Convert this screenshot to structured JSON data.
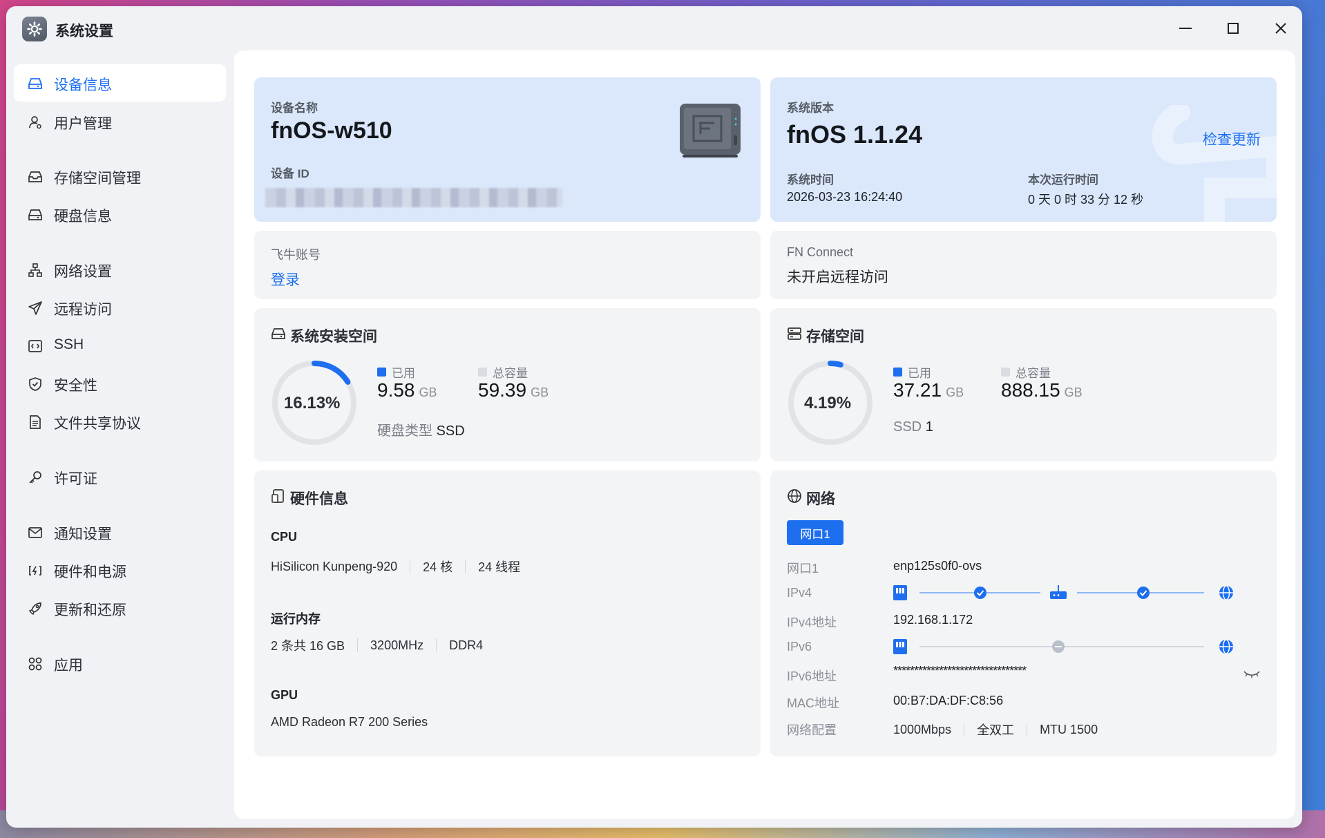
{
  "window": {
    "title": "系统设置"
  },
  "sidebar": {
    "items": [
      {
        "label": "设备信息",
        "icon": "device-drive-icon",
        "active": true
      },
      {
        "label": "用户管理",
        "icon": "user-icon"
      },
      {
        "label": "存储空间管理",
        "icon": "storage-icon"
      },
      {
        "label": "硬盘信息",
        "icon": "disk-icon"
      },
      {
        "label": "网络设置",
        "icon": "network-icon"
      },
      {
        "label": "远程访问",
        "icon": "send-icon"
      },
      {
        "label": "SSH",
        "icon": "ssh-icon"
      },
      {
        "label": "安全性",
        "icon": "shield-icon"
      },
      {
        "label": "文件共享协议",
        "icon": "file-icon"
      },
      {
        "label": "许可证",
        "icon": "key-icon"
      },
      {
        "label": "通知设置",
        "icon": "mail-icon"
      },
      {
        "label": "硬件和电源",
        "icon": "power-icon"
      },
      {
        "label": "更新和还原",
        "icon": "rocket-icon"
      },
      {
        "label": "应用",
        "icon": "apps-icon"
      }
    ]
  },
  "device": {
    "name_label": "设备名称",
    "name": "fnOS-w510",
    "id_label": "设备 ID"
  },
  "system": {
    "version_label": "系统版本",
    "version": "fnOS  1.1.24",
    "check_update": "检查更新",
    "time_label": "系统时间",
    "time": "2026-03-23 16:24:40",
    "uptime_label": "本次运行时间",
    "uptime": "0 天 0 时 33 分 12 秒"
  },
  "account": {
    "label": "飞牛账号",
    "login": "登录"
  },
  "fnconnect": {
    "label": "FN Connect",
    "status": "未开启远程访问"
  },
  "install_space": {
    "title": "系统安装空间",
    "percent_text": "16.13%",
    "percent": 16.13,
    "used_label": "已用",
    "used": "9.58",
    "total_label": "总容量",
    "total": "59.39",
    "unit": "GB",
    "disk_type_label": "硬盘类型",
    "disk_type": "SSD"
  },
  "storage_space": {
    "title": "存储空间",
    "percent_text": "4.19%",
    "percent": 4.19,
    "used_label": "已用",
    "used": "37.21",
    "total_label": "总容量",
    "total": "888.15",
    "unit": "GB",
    "ssd_label": "SSD",
    "ssd_count": "1"
  },
  "hardware": {
    "title": "硬件信息",
    "cpu_label": "CPU",
    "cpu_model": "HiSilicon Kunpeng-920",
    "cpu_cores": "24 核",
    "cpu_threads": "24 线程",
    "mem_label": "运行内存",
    "mem_size": "2 条共 16 GB",
    "mem_speed": "3200MHz",
    "mem_type": "DDR4",
    "gpu_label": "GPU",
    "gpu_model": "AMD Radeon R7 200 Series"
  },
  "network": {
    "title": "网络",
    "tab": "网口1",
    "port_label": "网口1",
    "port": "enp125s0f0-ovs",
    "ipv4_label": "IPv4",
    "ipv4_addr_label": "IPv4地址",
    "ipv4_addr": "192.168.1.172",
    "ipv6_label": "IPv6",
    "ipv6_addr_label": "IPv6地址",
    "ipv6_addr": "********************************",
    "mac_label": "MAC地址",
    "mac": "00:B7:DA:DF:C8:56",
    "config_label": "网络配置",
    "speed": "1000Mbps",
    "duplex": "全双工",
    "mtu": "MTU 1500"
  },
  "colors": {
    "accent": "#1e6ff0",
    "card_blue": "#dbe8fb",
    "card_grey": "#f3f4f6"
  }
}
